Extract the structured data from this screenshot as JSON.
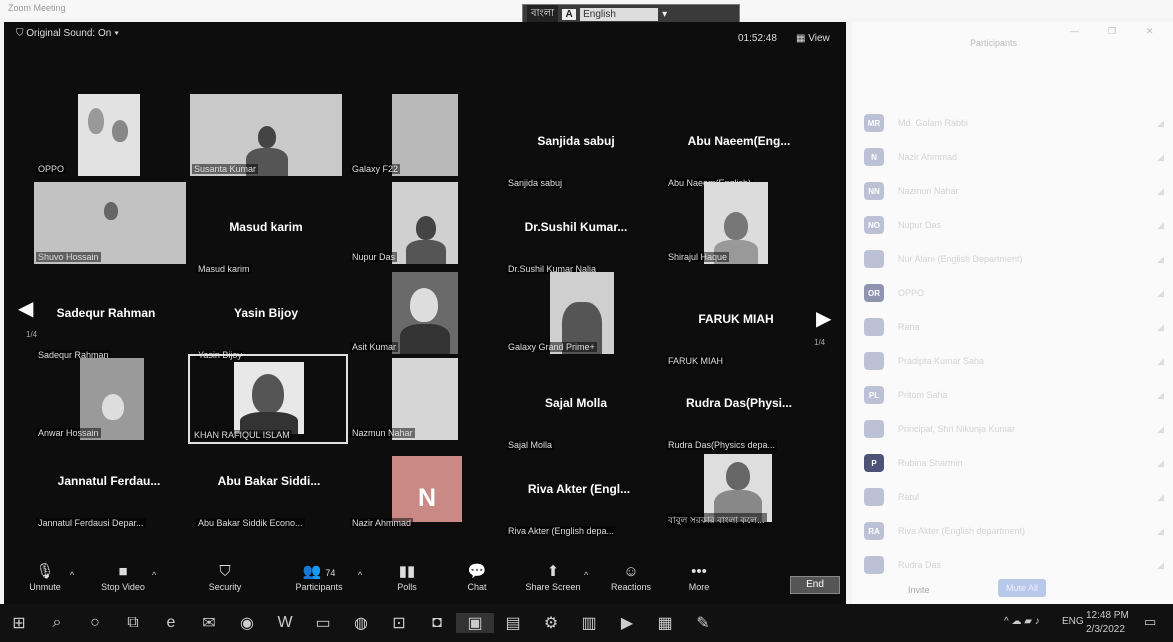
{
  "window": {
    "title": "Zoom Meeting"
  },
  "language_bar": {
    "bengali": "বাংলা",
    "indicator": "A",
    "selected": "English"
  },
  "meeting": {
    "original_sound": "Original Sound: On",
    "timer": "01:52:48",
    "view_label": "View",
    "page_left": "1/4",
    "page_right": "1/4"
  },
  "tiles": [
    {
      "name": "",
      "label": "OPPO"
    },
    {
      "name": "",
      "label": "Susanta Kumar"
    },
    {
      "name": "",
      "label": "Galaxy F22"
    },
    {
      "name": "Sanjida sabuj",
      "label": "Sanjida sabuj"
    },
    {
      "name": "Abu Naeem(Eng...",
      "label": "Abu Naeem(English)"
    },
    {
      "name": "",
      "label": "Shuvo Hossain"
    },
    {
      "name": "Masud karim",
      "label": "Masud karim"
    },
    {
      "name": "",
      "label": "Nupur Das"
    },
    {
      "name": "Dr.Sushil Kumar...",
      "label": "Dr.Sushil Kumar Nalia"
    },
    {
      "name": "",
      "label": "Shirajul Haque"
    },
    {
      "name": "Sadequr Rahman",
      "label": "Sadequr Rahman"
    },
    {
      "name": "Yasin Bijoy",
      "label": "Yasin Bijoy"
    },
    {
      "name": "",
      "label": "Asit Kumar"
    },
    {
      "name": "",
      "label": "Galaxy Grand Prime+"
    },
    {
      "name": "FARUK MIAH",
      "label": "FARUK MIAH"
    },
    {
      "name": "",
      "label": "Anwar Hossain"
    },
    {
      "name": "",
      "label": "KHAN RAFIQUL ISLAM"
    },
    {
      "name": "",
      "label": "Nazmun Nahar"
    },
    {
      "name": "Sajal Molla",
      "label": "Sajal Molla"
    },
    {
      "name": "Rudra Das(Physi...",
      "label": "Rudra Das(Physics depa..."
    },
    {
      "name": "Jannatul Ferdau...",
      "label": "Jannatul Ferdausi Depar..."
    },
    {
      "name": "Abu Bakar Siddi...",
      "label": "Abu Bakar Siddik Econo..."
    },
    {
      "name": "N",
      "label": "Nazir Ahmmad"
    },
    {
      "name": "Riva Akter (Engl...",
      "label": "Riva Akter (English depa..."
    },
    {
      "name": "",
      "label": "বাবুল সরকার বাংলা কলে..."
    }
  ],
  "controls": {
    "unmute": "Unmute",
    "stop_video": "Stop Video",
    "security": "Security",
    "participants": "Participants",
    "participants_count": "74",
    "polls": "Polls",
    "chat": "Chat",
    "share_screen": "Share Screen",
    "reactions": "Reactions",
    "more": "More",
    "end": "End"
  },
  "side_panel": {
    "title": "Participants",
    "participants": [
      {
        "initials": "MR",
        "name": "Md. Golam Rabbi"
      },
      {
        "initials": "N",
        "name": "Nazir Ahmmad"
      },
      {
        "initials": "NN",
        "name": "Nazmun Nahar"
      },
      {
        "initials": "NO",
        "name": "Nupur Das"
      },
      {
        "initials": "",
        "name": "Nur Alam (English Department)"
      },
      {
        "initials": "OR",
        "name": "OPPO"
      },
      {
        "initials": "",
        "name": "Rana"
      },
      {
        "initials": "",
        "name": "Pradipta Kumar Saha"
      },
      {
        "initials": "PL",
        "name": "Pritom Saha"
      },
      {
        "initials": "",
        "name": "Principal, Shri Nikunja Kumar"
      },
      {
        "initials": "P",
        "name": "Rubina Sharmin"
      },
      {
        "initials": "",
        "name": "Ratul"
      },
      {
        "initials": "RA",
        "name": "Riva Akter (English department)"
      },
      {
        "initials": "",
        "name": "Rudra Das"
      }
    ],
    "invite": "Invite",
    "mute_all": "Mute All"
  },
  "taskbar": {
    "time": "12:48 PM",
    "date": "2/3/2022",
    "lang": "ENG"
  },
  "colors": {
    "meeting_bg": "#0d0d0d",
    "panel_bg": "#fafafa",
    "avatar": "#bcc1d6"
  }
}
